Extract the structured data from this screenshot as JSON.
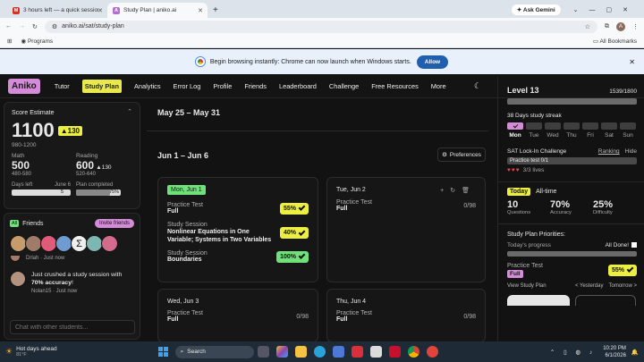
{
  "browser": {
    "tabs": [
      {
        "title": "3 hours left — a quick session",
        "fav": "M",
        "favcolor": "#d93025"
      },
      {
        "title": "Study Plan | aniko.ai",
        "fav": "A",
        "favcolor": "#b06ed1"
      }
    ],
    "new_tab": "+",
    "ask": "Ask Gemini",
    "url": "aniko.ai/sat/study-plan",
    "bookmark": "Programs",
    "all_bookmarks": "All Bookmarks",
    "notice": "Begin browsing instantly: Chrome can now launch when Windows starts.",
    "allow": "Allow",
    "profile": "A"
  },
  "nav": {
    "logo": "Aniko",
    "items": [
      "Tutor",
      "Study Plan",
      "Analytics",
      "Error Log",
      "Profile",
      "Friends",
      "Leaderboard",
      "Challenge",
      "Free Resources",
      "More"
    ]
  },
  "score": {
    "title": "Score Estimate",
    "value": "1100",
    "delta": "▲130",
    "range": "980-1200",
    "math_label": "Math",
    "math": "500",
    "math_range": "480-580",
    "reading_label": "Reading",
    "reading": "600",
    "reading_delta": "▲130",
    "reading_range": "520-640",
    "days_left_label": "Days left",
    "days_left_date": "June 6",
    "days_left": "5",
    "plan_label": "Plan completed",
    "plan_pct": "75%",
    "plan_fraction": 0.75
  },
  "friends": {
    "title": "Friends",
    "invite": "Invite friends",
    "avatars": [
      "#c69c6d",
      "#9f7b6a",
      "#e05b7a",
      "#6f9bd1",
      "#efefef",
      "#7db7b2",
      "#d36b8c"
    ],
    "item1_meta": "Drlah · Just now",
    "item2_text_a": "Just crushed a study session with ",
    "item2_bold": "70% accuracy",
    "item2_text_b": "!",
    "item2_meta": "Nolan15 · Just now",
    "chat_placeholder": "Chat with other students..."
  },
  "week": {
    "top": "May 25 – May 31",
    "range": "Jun 1 – Jun 6",
    "preferences": "Preferences"
  },
  "days": [
    {
      "date": "Mon, Jun 1",
      "items": [
        {
          "type": "Practice Test",
          "name": "Full",
          "badge": "55%",
          "color": "#ecef3f"
        },
        {
          "type": "Study Session",
          "name": "Nonlinear Equations in One Variable; Systems in Two Variables",
          "badge": "40%",
          "color": "#ecef3f"
        },
        {
          "type": "Study Session",
          "name": "Boundaries",
          "badge": "100%",
          "color": "#6fe07a"
        }
      ]
    },
    {
      "date": "Tue, Jun 2",
      "items": [
        {
          "type": "Practice Test",
          "name": "Full",
          "score": "0/98"
        }
      ]
    },
    {
      "date": "Wed, Jun 3",
      "items": [
        {
          "type": "Practice Test",
          "name": "Full",
          "score": "0/98"
        }
      ]
    },
    {
      "date": "Thu, Jun 4",
      "items": [
        {
          "type": "Practice Test",
          "name": "Full",
          "score": "0/98"
        }
      ]
    }
  ],
  "right": {
    "level": "Level 13",
    "xp": "1539/1800",
    "streak": "38 Days study streak",
    "days": [
      "Mon",
      "Tue",
      "Wed",
      "Thu",
      "Fri",
      "Sat",
      "Sun"
    ],
    "challenge": "SAT Lock-In Challenge",
    "ranking": "Ranking",
    "hide": "Hide",
    "challenge_item": "Practice test 0/1",
    "lives": "3/3 lives",
    "today": "Today",
    "alltime": "All-time",
    "stats": [
      {
        "v": "10",
        "l": "Questions"
      },
      {
        "v": "70%",
        "l": "Accuracy"
      },
      {
        "v": "25%",
        "l": "Difficulty"
      }
    ],
    "priorities": "Study Plan Priorities:",
    "progress": "Today's progress",
    "all_done": "All Done!",
    "pt": "Practice Test",
    "full": "Full",
    "pt_badge": "55%",
    "view": "View Study Plan",
    "yesterday": "< Yesterday",
    "tomorrow": "Tomorrow >"
  },
  "taskbar": {
    "weather": "Hot days ahead",
    "temp": "81°F",
    "search": "Search",
    "time": "10:20 PM",
    "date": "6/1/2026"
  }
}
